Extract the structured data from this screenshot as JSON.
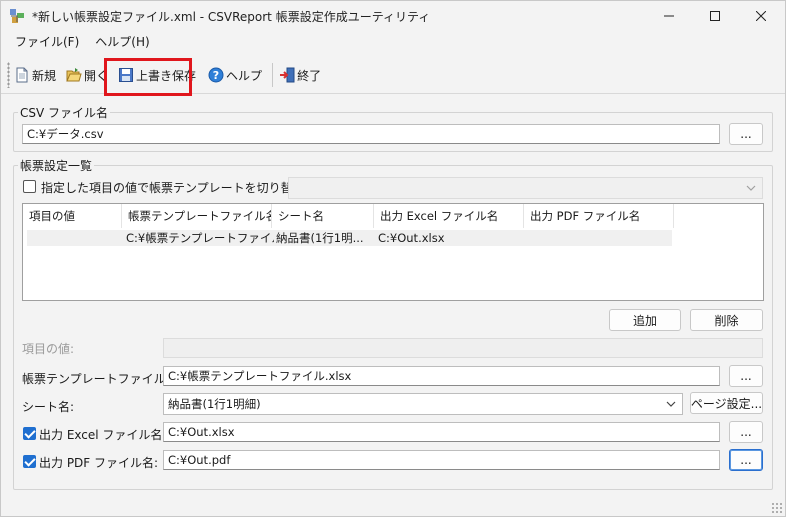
{
  "window": {
    "title": "*新しい帳票設定ファイル.xml - CSVReport 帳票設定作成ユーティリティ"
  },
  "menu": [
    {
      "label": "ファイル(F)"
    },
    {
      "label": "ヘルプ(H)"
    }
  ],
  "toolbar": {
    "new_label": "新規",
    "open_label": "開く",
    "save_label": "上書き保存",
    "help_label": "ヘルプ",
    "exit_label": "終了"
  },
  "csv_group": {
    "title": "CSV ファイル名",
    "value": "C:¥データ.csv",
    "browse_label": "..."
  },
  "settings_group": {
    "title": "帳票設定一覧",
    "switch_checkbox_label": "指定した項目の値で帳票テンプレートを切り替える:",
    "switch_checked": false,
    "list": {
      "columns": [
        "項目の値",
        "帳票テンプレートファイル名",
        "シート名",
        "出力 Excel ファイル名",
        "出力 PDF ファイル名"
      ],
      "rows": [
        [
          "",
          "C:¥帳票テンプレートファイル...",
          "納品書(1行1明...",
          "C:¥Out.xlsx",
          ""
        ]
      ]
    },
    "add_label": "追加",
    "delete_label": "削除",
    "item_value_label": "項目の値:",
    "item_value": "",
    "template_label": "帳票テンプレートファイル名:",
    "template_value": "C:¥帳票テンプレートファイル.xlsx",
    "template_browse": "...",
    "sheet_label": "シート名:",
    "sheet_value": "納品書(1行1明細)",
    "page_setup_label": "ページ設定...",
    "excel_label": "出力 Excel ファイル名:",
    "excel_checked": true,
    "excel_value": "C:¥Out.xlsx",
    "excel_browse": "...",
    "pdf_label": "出力 PDF ファイル名:",
    "pdf_checked": true,
    "pdf_value": "C:¥Out.pdf",
    "pdf_browse": "..."
  },
  "colors": {
    "highlight": "#e0161c",
    "checkbox_checked": "#1f6fd0"
  }
}
